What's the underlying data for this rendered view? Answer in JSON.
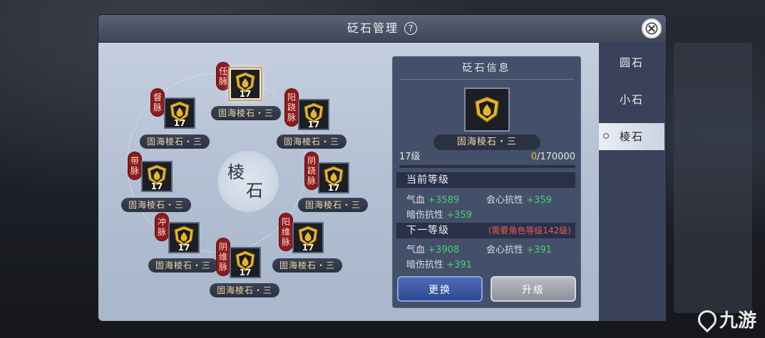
{
  "dialog": {
    "title": "砭石管理",
    "help_label": "?"
  },
  "center_label": {
    "line1": "棱",
    "line2": "石"
  },
  "slots": [
    {
      "id": "ren",
      "meridian": "任脉",
      "level": "17",
      "stone": "固海棱石・三",
      "selected": true
    },
    {
      "id": "du",
      "meridian": "督脉",
      "level": "17",
      "stone": "固海棱石・三",
      "selected": false
    },
    {
      "id": "yangqiao",
      "meridian": "阳跷脉",
      "level": "17",
      "stone": "固海棱石・三",
      "selected": false
    },
    {
      "id": "dai",
      "meridian": "带脉",
      "level": "17",
      "stone": "固海棱石・三",
      "selected": false
    },
    {
      "id": "yinqiao",
      "meridian": "阴跷脉",
      "level": "17",
      "stone": "固海棱石・三",
      "selected": false
    },
    {
      "id": "chong",
      "meridian": "冲脉",
      "level": "17",
      "stone": "固海棱石・三",
      "selected": false
    },
    {
      "id": "yangwei",
      "meridian": "阳维脉",
      "level": "17",
      "stone": "固海棱石・三",
      "selected": false
    },
    {
      "id": "yinwei",
      "meridian": "阴维脉",
      "level": "17",
      "stone": "固海棱石・三",
      "selected": false
    }
  ],
  "info": {
    "title": "砭石信息",
    "stone_name": "固海棱石・三",
    "level_label": "17级",
    "exp_current": "0",
    "exp_total": "/170000",
    "exp_fraction": 0,
    "current": {
      "header": "当前等级",
      "stats": [
        {
          "label": "气血",
          "value": "+3589"
        },
        {
          "label": "会心抗性",
          "value": "+359"
        },
        {
          "label": "暗伤抗性",
          "value": "+359"
        }
      ]
    },
    "next": {
      "header": "下一等级",
      "requirement": "(需要角色等级142级)",
      "stats": [
        {
          "label": "气血",
          "value": "+3908"
        },
        {
          "label": "会心抗性",
          "value": "+391"
        },
        {
          "label": "暗伤抗性",
          "value": "+391"
        }
      ]
    },
    "buttons": {
      "replace": "更换",
      "upgrade": "升级"
    }
  },
  "tabs": [
    {
      "label": "圆石",
      "active": false
    },
    {
      "label": "小石",
      "active": false
    },
    {
      "label": "棱石",
      "active": true
    }
  ],
  "watermark": {
    "text": "九游"
  },
  "colors": {
    "accent_gold": "#f0c33c",
    "stat_green": "#46d26a",
    "requirement_red": "#e85a4f",
    "tag_red": "#8e1a1f"
  },
  "icons": {
    "gem": "gold-shield-drop-icon",
    "close": "close-icon",
    "help": "help-icon"
  }
}
